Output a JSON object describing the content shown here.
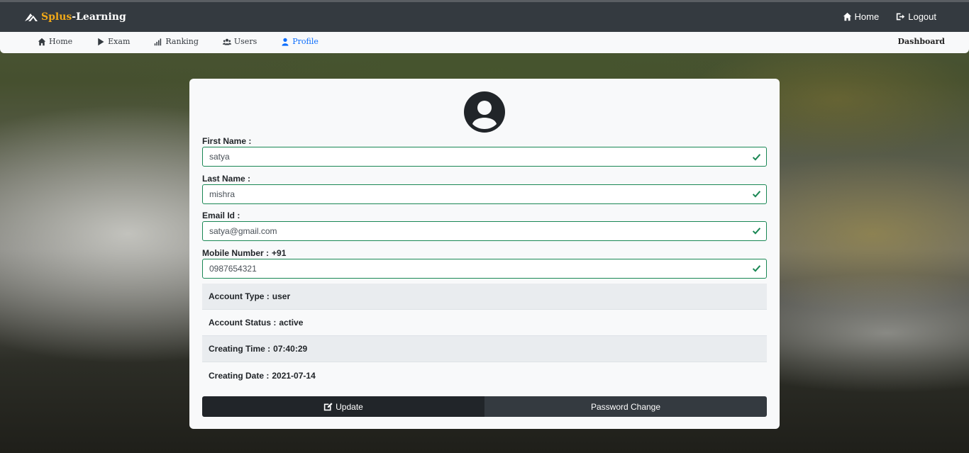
{
  "brand": {
    "part1": "Splus",
    "part2": "-Learning"
  },
  "topnav": {
    "home": "Home",
    "logout": "Logout"
  },
  "subnav": {
    "items": [
      {
        "label": "Home",
        "icon": "home-icon"
      },
      {
        "label": "Exam",
        "icon": "play-icon"
      },
      {
        "label": "Ranking",
        "icon": "signal-bars-icon"
      },
      {
        "label": "Users",
        "icon": "users-icon"
      },
      {
        "label": "Profile",
        "icon": "user-icon",
        "active": true
      }
    ],
    "right_label": "Dashboard"
  },
  "profile": {
    "first_name": {
      "label": "First Name :",
      "value": "satya"
    },
    "last_name": {
      "label": "Last Name :",
      "value": "mishra"
    },
    "email": {
      "label": "Email Id :",
      "value": "satya@gmail.com"
    },
    "mobile": {
      "label": "Mobile Number :",
      "prefix": "+91",
      "value": "0987654321"
    },
    "account_type": {
      "label": "Account Type :",
      "value": "user"
    },
    "account_status": {
      "label": "Account Status :",
      "value": "active"
    },
    "creating_time": {
      "label": "Creating Time :",
      "value": "07:40:29"
    },
    "creating_date": {
      "label": "Creating Date :",
      "value": "2021-07-14"
    }
  },
  "buttons": {
    "update": "Update",
    "password_change": "Password Change"
  },
  "colors": {
    "accent": "#f0a818",
    "valid": "#198754",
    "active_link": "#0d6efd",
    "navbar": "#343a40"
  }
}
